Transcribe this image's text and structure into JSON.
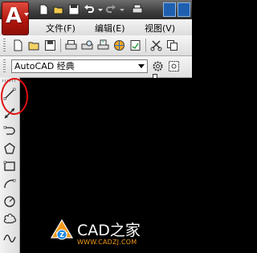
{
  "app": {
    "logo_letter": "A"
  },
  "menubar": {
    "items": [
      "文件(F)",
      "编辑(E)",
      "视图(V)"
    ]
  },
  "workspace": {
    "selected": "AutoCAD 经典"
  },
  "watermark": {
    "title": "CAD之家",
    "url": "WWW.CADZJ.COM"
  },
  "icons": {
    "quick_access": [
      "new-icon",
      "open-icon",
      "save-icon",
      "undo-icon",
      "redo-icon",
      "plot-icon"
    ],
    "standard_toolbar": [
      "new-icon",
      "open-icon",
      "save-icon",
      "plot-icon",
      "plot-preview-icon",
      "publish-icon",
      "3d-dwf-icon",
      "cut-icon",
      "copy-icon"
    ],
    "draw_toolbar": [
      "line-icon",
      "construction-line-icon",
      "polyline-icon",
      "polygon-icon",
      "rectangle-icon",
      "arc-icon",
      "circle-icon",
      "revision-cloud-icon",
      "spline-icon"
    ]
  },
  "colors": {
    "app_button": "#c0221a",
    "highlight_circle": "#e01010",
    "watermark_accent": "#f39a1a",
    "canvas": "#000000"
  }
}
